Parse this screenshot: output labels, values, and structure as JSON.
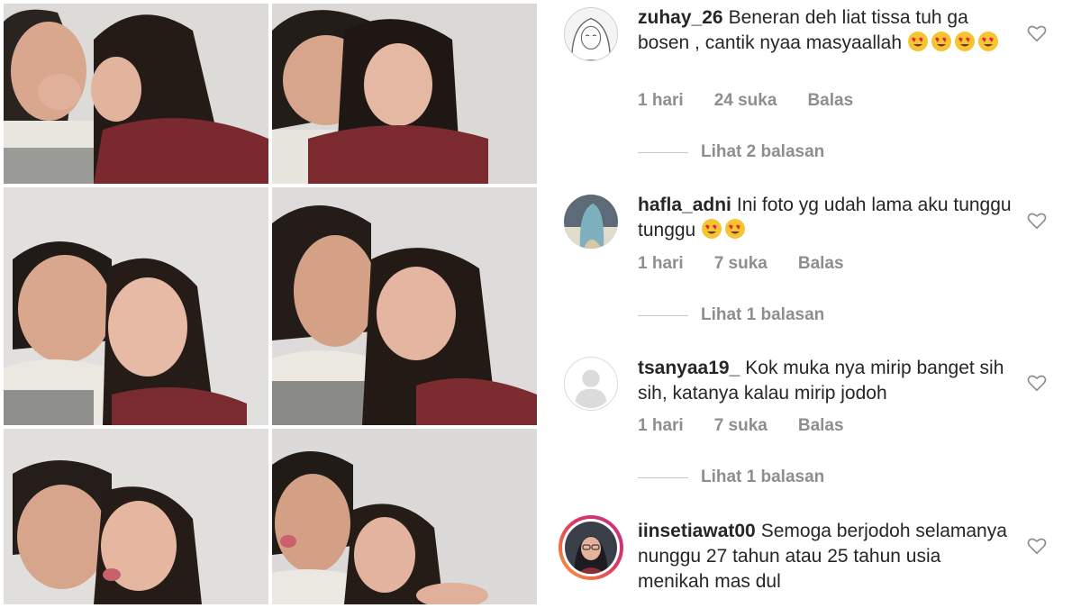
{
  "photos": [
    {
      "name": "photo-top-left"
    },
    {
      "name": "photo-top-right"
    },
    {
      "name": "photo-middle-left"
    },
    {
      "name": "photo-middle-right"
    },
    {
      "name": "photo-bottom-left"
    },
    {
      "name": "photo-bottom-right"
    }
  ],
  "comments": [
    {
      "username": "zuhay_26",
      "text": "Beneran deh liat tissa tuh ga bosen , cantik nyaa masyaallah",
      "emojis": 4,
      "time": "1 hari",
      "likes": "24 suka",
      "reply": "Balas",
      "view_replies": "Lihat 2 balasan",
      "avatar": "hijab-drawing-avatar"
    },
    {
      "username": "hafla_adni",
      "text": "Ini foto yg udah lama aku tunggu tunggu",
      "emojis": 2,
      "time": "1 hari",
      "likes": "7 suka",
      "reply": "Balas",
      "view_replies": "Lihat 1 balasan",
      "avatar": "hijab-photo-avatar"
    },
    {
      "username": "tsanyaa19_",
      "text": "Kok muka nya mirip banget sih sih, katanya kalau mirip jodoh",
      "emojis": 0,
      "time": "1 hari",
      "likes": "7 suka",
      "reply": "Balas",
      "view_replies": "Lihat 1 balasan",
      "avatar": "default-user-avatar"
    },
    {
      "username": "iinsetiawat00",
      "text": "Semoga berjodoh selamanya nunggu 27 tahun atau 25 tahun usia menikah mas dul",
      "emojis": 0,
      "avatar": "story-ring-avatar"
    }
  ],
  "colors": {
    "text": "#262626",
    "muted": "#8e8e8e",
    "story_ring_start": "#f9a13a",
    "story_ring_end": "#c22f8a",
    "maroon_top": "#7a2a2e"
  }
}
